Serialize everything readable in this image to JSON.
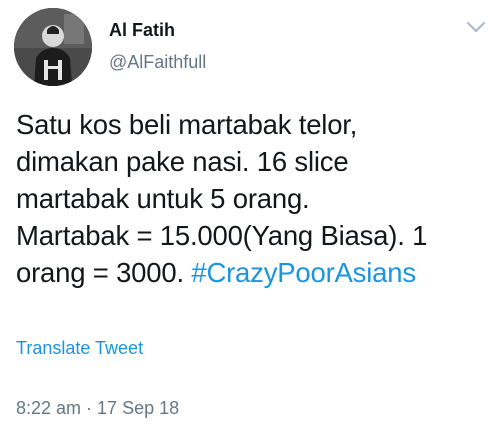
{
  "author": {
    "name": "Al Fatih",
    "handle": "@AlFaithfull"
  },
  "tweet": {
    "lines": [
      "Satu kos beli martabak telor,",
      "dimakan pake nasi. 16 slice",
      "martabak untuk 5 orang.",
      "Martabak = 15.000(Yang Biasa). 1"
    ],
    "last_line_prefix": "orang = 3000. ",
    "hashtag": "#CrazyPoorAsians"
  },
  "translate_label": "Translate Tweet",
  "meta": {
    "time": "8:22 am",
    "separator": " · ",
    "date": "17 Sep 18"
  },
  "icons": {
    "menu": "chevron-down-icon"
  },
  "colors": {
    "text": "#14171a",
    "secondary": "#657786",
    "link": "#1b95e0"
  }
}
